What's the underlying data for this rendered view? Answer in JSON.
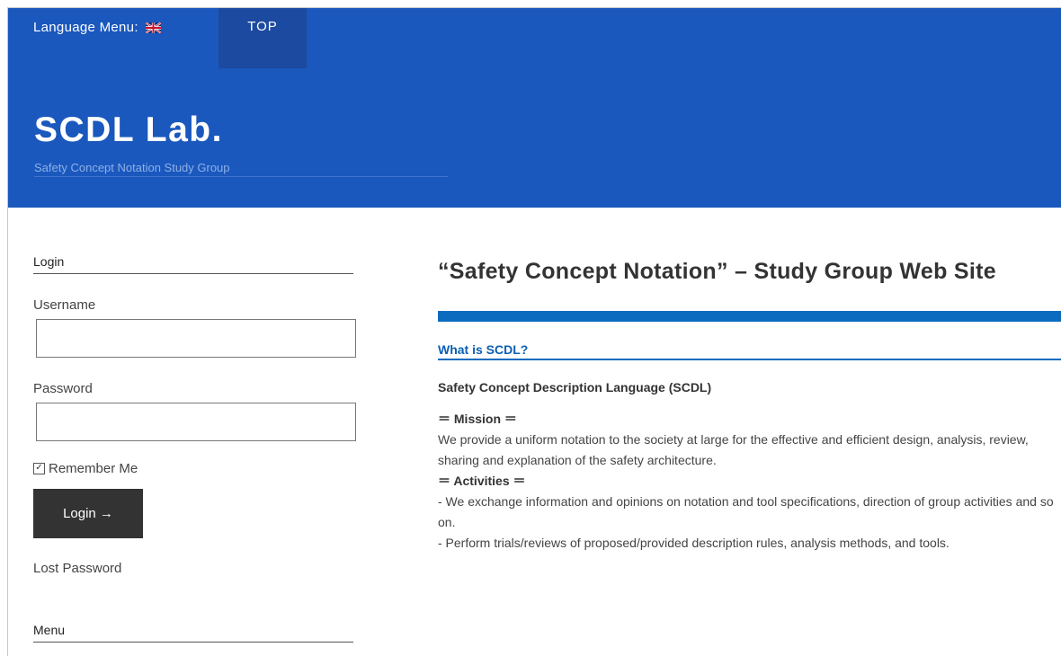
{
  "header": {
    "language_menu_label": "Language Menu:",
    "nav_top": "TOP",
    "site_title": "SCDL Lab.",
    "tagline": "Safety Concept Notation Study Group"
  },
  "sidebar": {
    "login_widget_title": "Login",
    "username_label": "Username",
    "username_value": "",
    "password_label": "Password",
    "password_value": "",
    "remember_label": "Remember Me",
    "login_button": "Login →",
    "lost_password": "Lost Password",
    "menu_widget_title": "Menu"
  },
  "content": {
    "page_title": "“Safety Concept Notation” – Study Group Web Site",
    "section_title": "What is SCDL?",
    "lead": "Safety Concept Description Language (SCDL)",
    "mission_heading": "＝ Mission ＝",
    "mission_text": "We provide a uniform notation to the society at large for the effective and efficient design, analysis, review, sharing and explanation of the safety architecture.",
    "activities_heading": "＝ Activities ＝",
    "activity_1": "- We exchange information and opinions on notation and tool specifications, direction of group activities and so on.",
    "activity_2": "- Perform trials/reviews of proposed/provided description rules, analysis methods, and tools."
  },
  "colors": {
    "header_bg": "#1a58bd",
    "nav_active_bg": "#1c4aa0",
    "accent_blue": "#0c6bbf",
    "button_bg": "#333333"
  },
  "icons": {
    "language_flag": "uk-flag-icon",
    "checkbox": "checked-checkbox-icon"
  }
}
